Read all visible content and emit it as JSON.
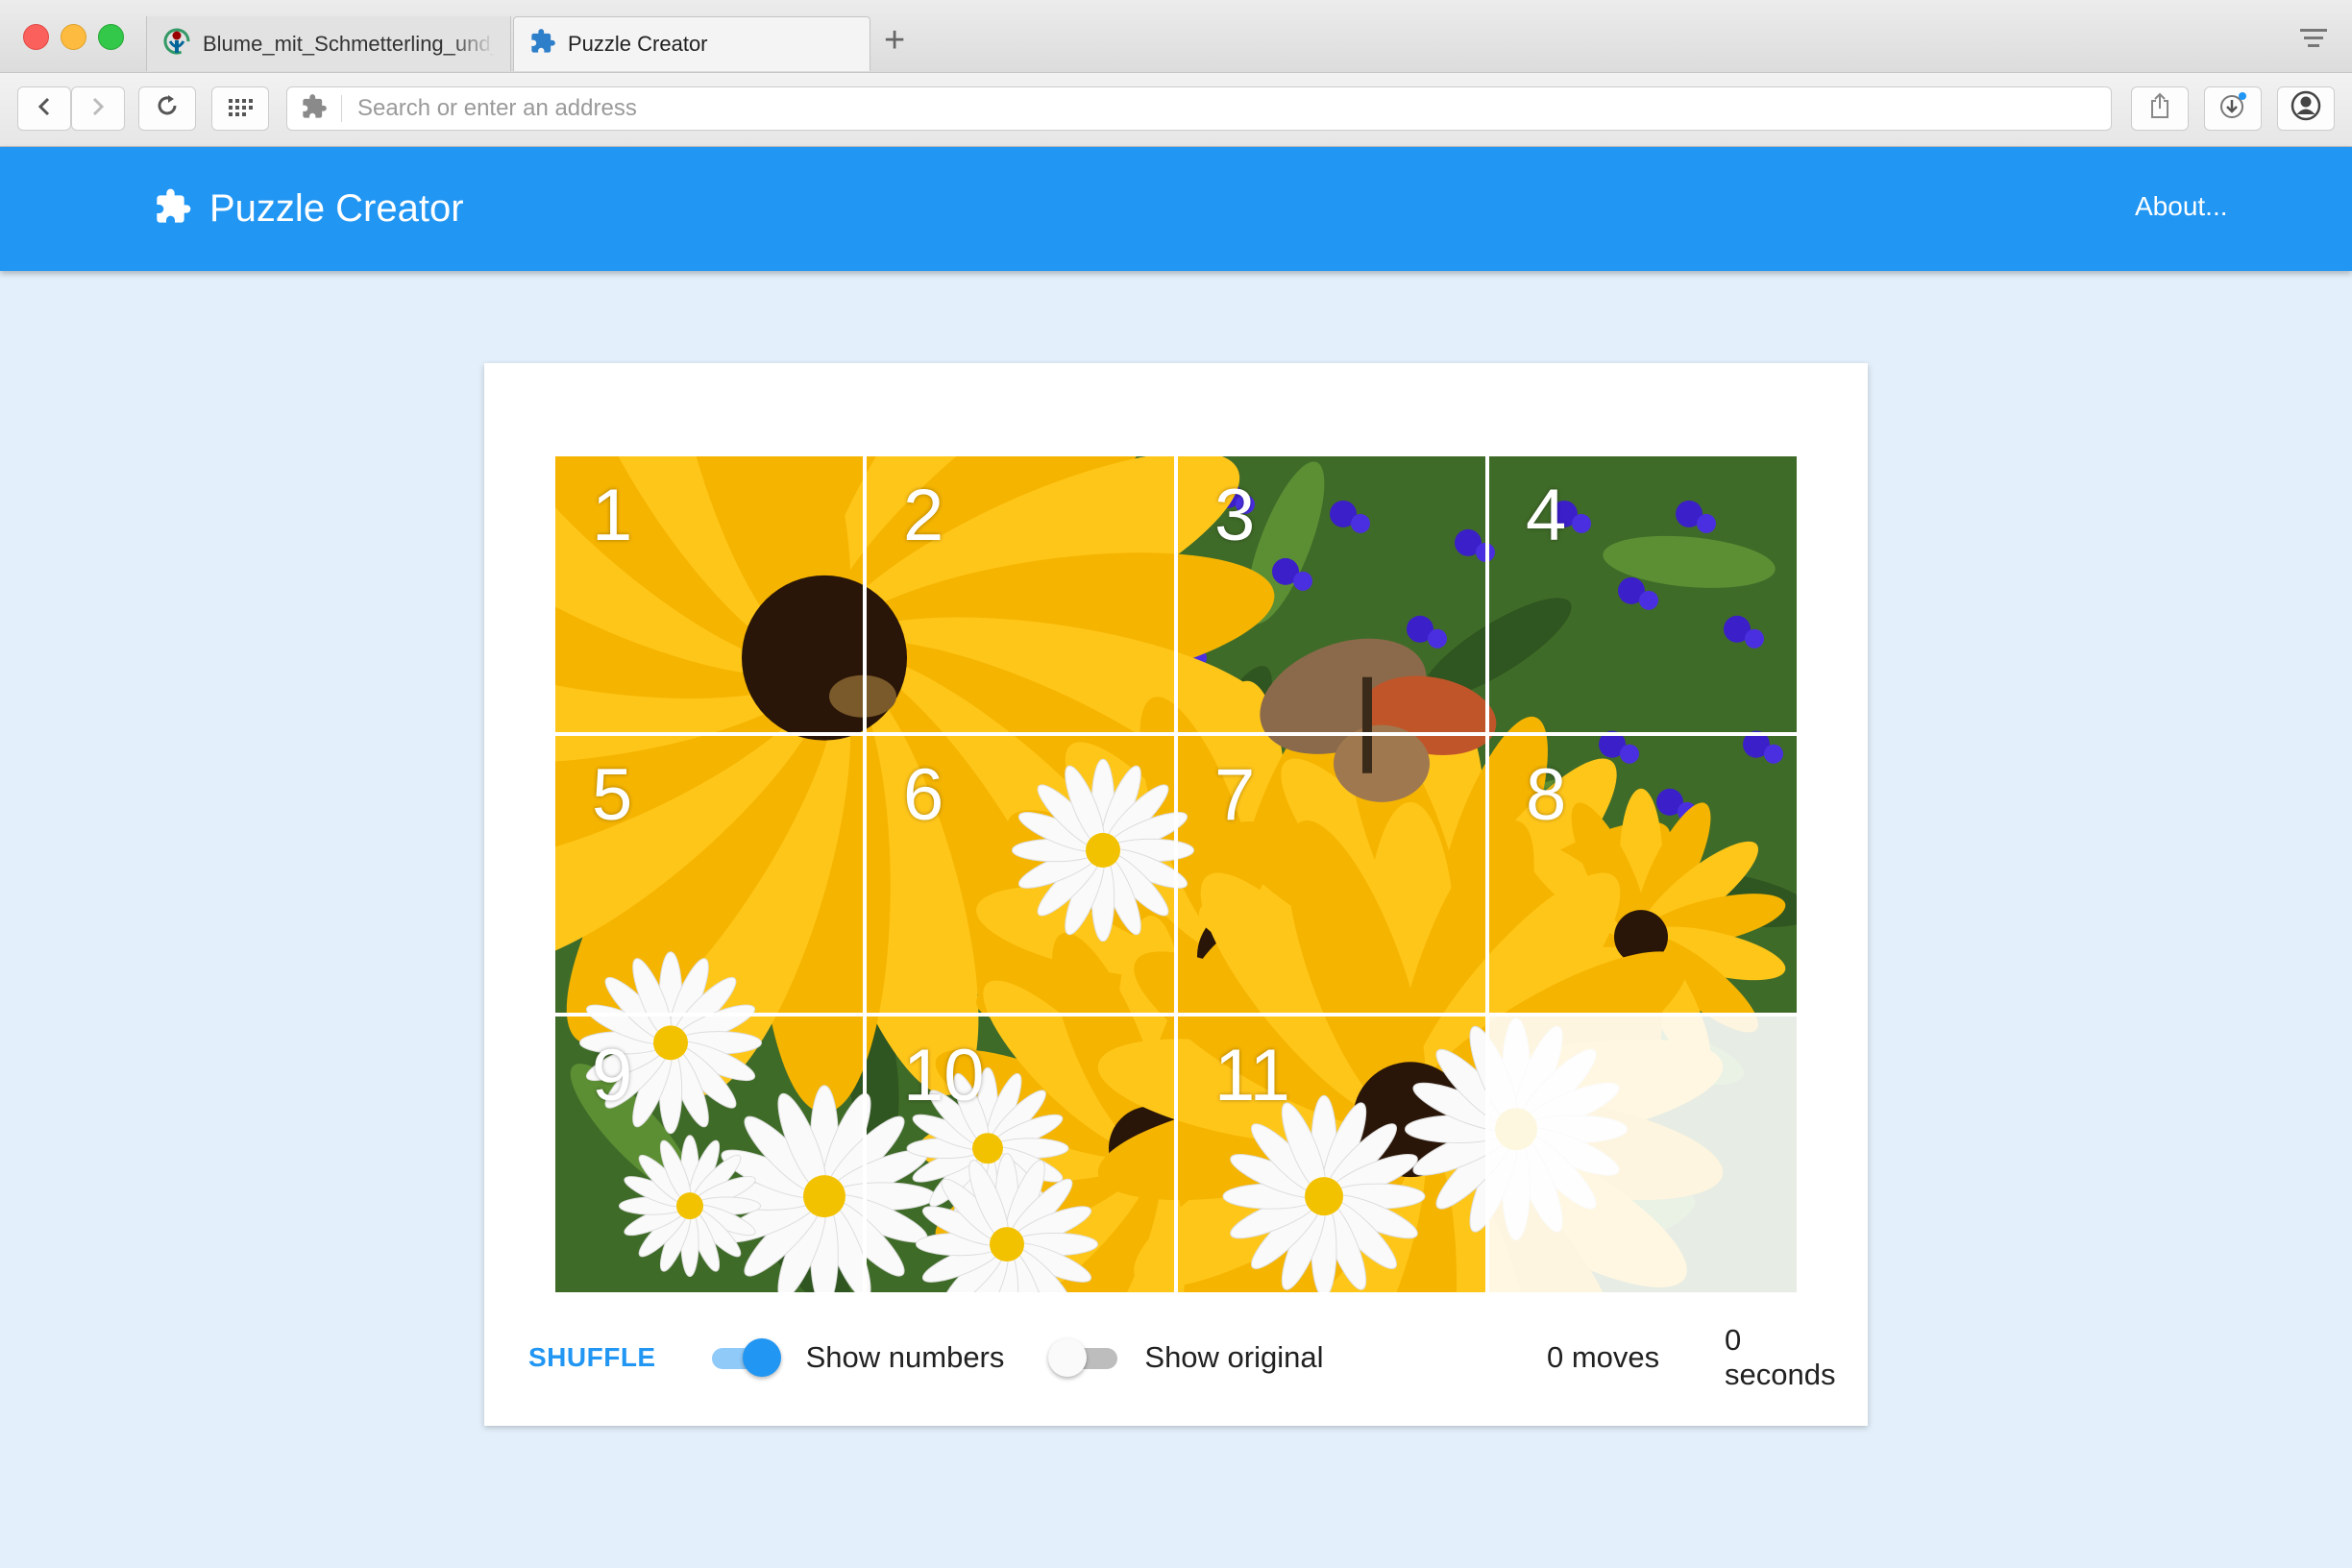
{
  "browser": {
    "tabs": [
      {
        "label": "Blume_mit_Schmetterling_und_Biene",
        "active": false,
        "icon": "wikimedia-icon"
      },
      {
        "label": "Puzzle Creator",
        "active": true,
        "icon": "puzzle-piece-icon"
      }
    ],
    "address_placeholder": "Search or enter an address"
  },
  "app": {
    "title": "Puzzle Creator",
    "about_label": "About...",
    "accent_color": "#2196f3",
    "background_color": "#e3f0fb"
  },
  "puzzle": {
    "columns": 4,
    "rows": 3,
    "tiles": [
      {
        "number": "1"
      },
      {
        "number": "2"
      },
      {
        "number": "3"
      },
      {
        "number": "4"
      },
      {
        "number": "5"
      },
      {
        "number": "6"
      },
      {
        "number": "7"
      },
      {
        "number": "8"
      },
      {
        "number": "9"
      },
      {
        "number": "10"
      },
      {
        "number": "11"
      },
      {
        "number": ""
      }
    ],
    "empty_tile_index": 11
  },
  "controls": {
    "shuffle_label": "SHUFFLE",
    "show_numbers_label": "Show numbers",
    "show_numbers_on": true,
    "show_original_label": "Show original",
    "show_original_on": false,
    "moves_text": "0 moves",
    "seconds_text": "0 seconds"
  }
}
